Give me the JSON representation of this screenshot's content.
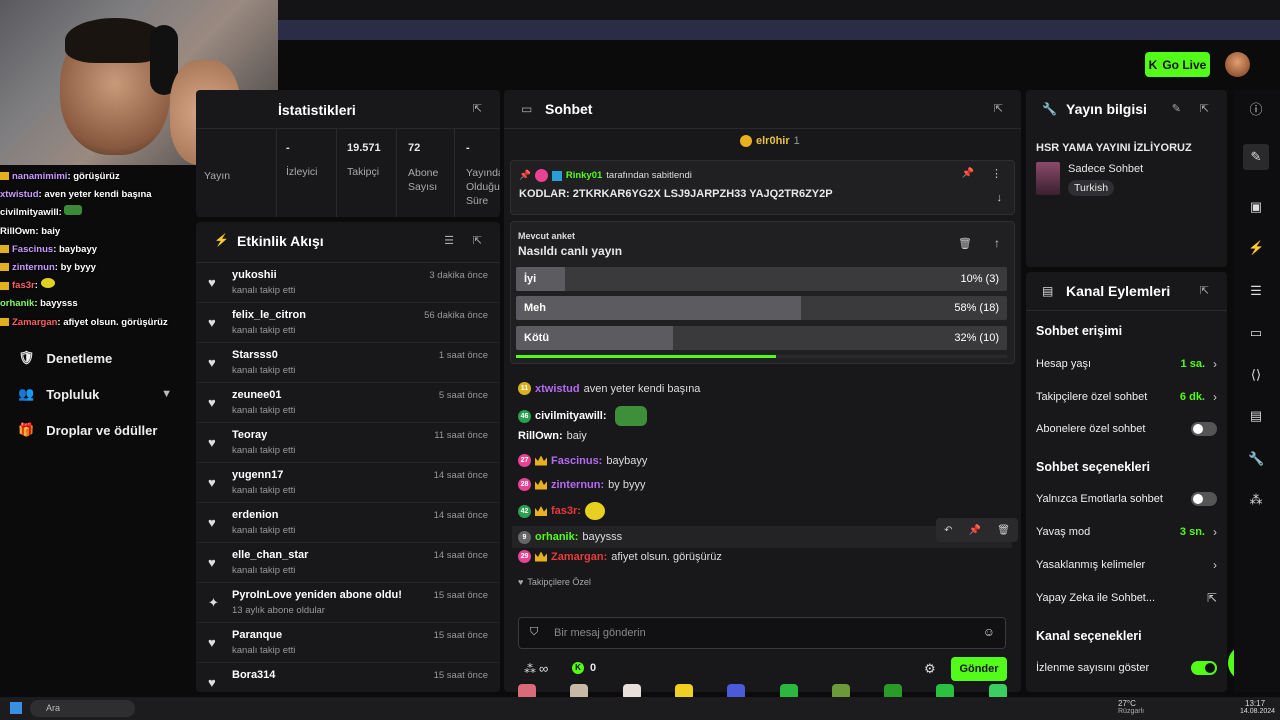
{
  "topbar": {
    "go_live": "Go Live"
  },
  "webcam_chat": [
    {
      "user": "nanamimimi",
      "text": "görüşürüz"
    },
    {
      "user": "xtwistud",
      "text": "aven yeter kendi başına"
    },
    {
      "user": "civilmityawill",
      "text": ""
    },
    {
      "user": "RillOwn",
      "text": "baiy"
    },
    {
      "user": "Fascinus",
      "text": "baybayy"
    },
    {
      "user": "zinternun",
      "text": "by byyy"
    },
    {
      "user": "fas3r",
      "text": ""
    },
    {
      "user": "orhanik",
      "text": "bayysss"
    },
    {
      "user": "Zamargan",
      "text": "afiyet olsun. görüşürüz"
    }
  ],
  "left_nav": {
    "items": [
      {
        "label": "Denetleme"
      },
      {
        "label": "Topluluk"
      },
      {
        "label": "Droplar ve ödüller"
      }
    ]
  },
  "stats": {
    "title": "İstatistikleri",
    "columns": [
      {
        "value": "",
        "label": "Yayın"
      },
      {
        "value": "-",
        "label": "İzleyici"
      },
      {
        "value": "19.571",
        "label": "Takipçi"
      },
      {
        "value": "72",
        "label": "Abone Sayısı"
      },
      {
        "value": "-",
        "label": "Yayında Olduğu Süre"
      }
    ]
  },
  "activity": {
    "title": "Etkinlik Akışı",
    "items": [
      {
        "name": "yukoshii",
        "sub": "kanalı takip etti",
        "time": "3 dakika önce"
      },
      {
        "name": "felix_le_citron",
        "sub": "kanalı takip etti",
        "time": "56 dakika önce"
      },
      {
        "name": "Starsss0",
        "sub": "kanalı takip etti",
        "time": "1 saat önce"
      },
      {
        "name": "zeunee01",
        "sub": "kanalı takip etti",
        "time": "5 saat önce"
      },
      {
        "name": "Teoray",
        "sub": "kanalı takip etti",
        "time": "11 saat önce"
      },
      {
        "name": "yugenn17",
        "sub": "kanalı takip etti",
        "time": "14 saat önce"
      },
      {
        "name": "erdenion",
        "sub": "kanalı takip etti",
        "time": "14 saat önce"
      },
      {
        "name": "elle_chan_star",
        "sub": "kanalı takip etti",
        "time": "14 saat önce"
      },
      {
        "name": "PyroInLove yeniden abone oldu!",
        "sub": "13 aylık abone oldular",
        "time": "15 saat önce"
      },
      {
        "name": "Paranque",
        "sub": "kanalı takip etti",
        "time": "15 saat önce"
      },
      {
        "name": "Bora314",
        "sub": "",
        "time": "15 saat önce"
      }
    ]
  },
  "chat": {
    "title": "Sohbet",
    "top_user": "elr0hir",
    "top_count": "1",
    "pinned_by": "Rinky01",
    "pinned_suffix": "tarafından sabitlendi",
    "pinned_text": "KODLAR: 2TKRKAR6YG2X LSJ9JARPZH33 YAJQ2TR6ZY2P",
    "poll": {
      "label": "Mevcut anket",
      "question": "Nasıldı canlı yayın",
      "options": [
        {
          "label": "İyi",
          "pct": 10,
          "display": "10% (3)"
        },
        {
          "label": "Meh",
          "pct": 58,
          "display": "58% (18)"
        },
        {
          "label": "Kötü",
          "pct": 32,
          "display": "32% (10)"
        }
      ],
      "timer_fraction": 0.53
    },
    "messages": [
      {
        "lvl": "11",
        "user": "xtwistud",
        "text": "aven yeter kendi başına",
        "color": "#b46bf0",
        "crown": false
      },
      {
        "lvl": "46",
        "user": "civilmityawill:",
        "text": "",
        "color": "#ffffff",
        "crown": false
      },
      {
        "lvl": "",
        "user": "RillOwn:",
        "text": "baiy",
        "color": "#ffffff",
        "crown": false
      },
      {
        "lvl": "27",
        "user": "Fascinus:",
        "text": "baybayy",
        "color": "#b46bf0",
        "crown": true
      },
      {
        "lvl": "28",
        "user": "zinternun:",
        "text": "by byyy",
        "color": "#b46bf0",
        "crown": true
      },
      {
        "lvl": "42",
        "user": "fas3r:",
        "text": "",
        "color": "#e83a3a",
        "crown": true
      },
      {
        "lvl": "9",
        "user": "orhanik:",
        "text": "bayysss",
        "color": "#53fc18",
        "crown": false
      },
      {
        "lvl": "29",
        "user": "Zamargan:",
        "text": "afiyet olsun. görüşürüz",
        "color": "#e83a3a",
        "crown": true
      }
    ],
    "followers_only": "Takipçilere Özel",
    "input_placeholder": "Bir mesaj gönderin",
    "kicks_count": "0",
    "send": "Gönder"
  },
  "info": {
    "title": "Yayın bilgisi",
    "stream_title": "HSR YAMA YAYINI İZLİYORUZ",
    "category": "Sadece Sohbet",
    "language": "Turkish"
  },
  "actions": {
    "title": "Kanal Eylemleri",
    "chat_access": "Sohbet erişimi",
    "account_age": "Hesap yaşı",
    "account_age_val": "1 sa.",
    "followers_chat": "Takipçilere özel sohbet",
    "followers_chat_val": "6 dk.",
    "subs_chat": "Abonelere özel sohbet",
    "chat_options": "Sohbet seçenekleri",
    "emote_only": "Yalnızca Emotlarla sohbet",
    "slow_mode": "Yavaş mod",
    "slow_mode_val": "3 sn.",
    "banned_words": "Yasaklanmış kelimeler",
    "ai_chat": "Yapay Zeka ile Sohbet...",
    "channel_options": "Kanal seçenekleri",
    "show_views": "İzlenme sayısını göster"
  },
  "taskbar": {
    "search": "Ara",
    "weather_temp": "27°C",
    "weather_desc": "Rüzgarlı",
    "time": "13:17",
    "date": "14.08.2024"
  },
  "colors": {
    "accent": "#53fc18",
    "panel": "#18181b",
    "bg": "#0b0b0c"
  }
}
